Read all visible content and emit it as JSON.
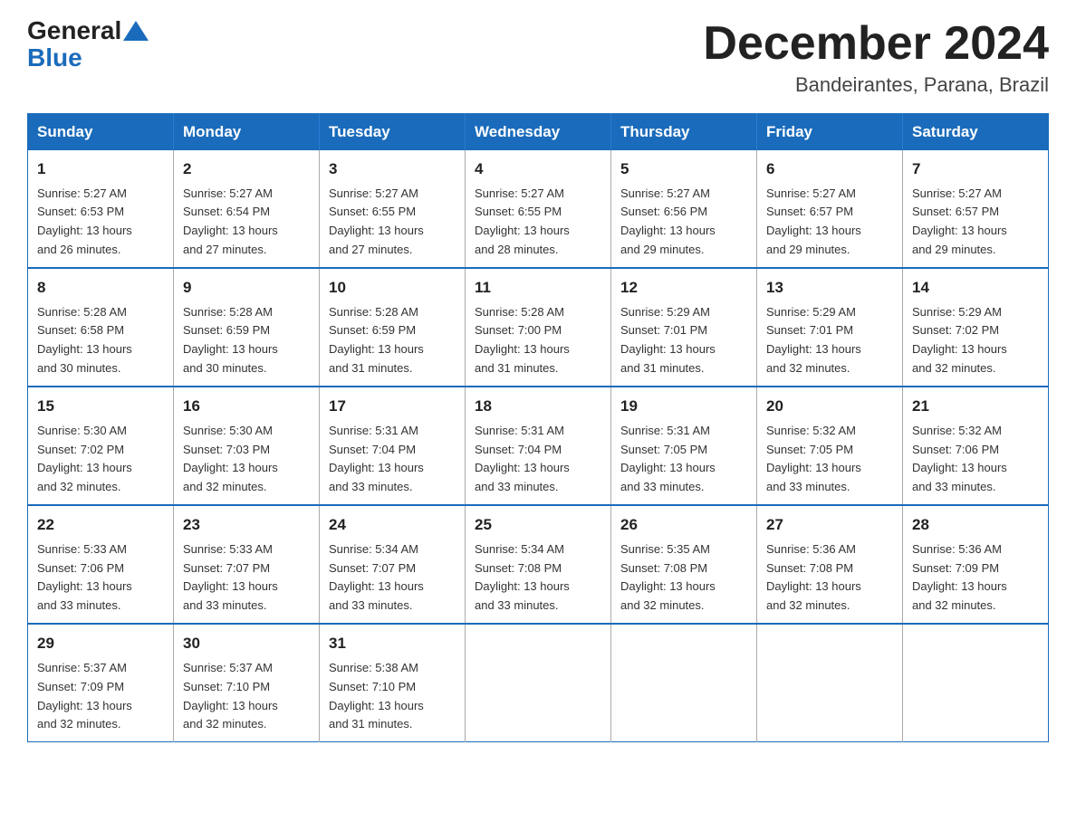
{
  "logo": {
    "general": "General",
    "blue": "Blue"
  },
  "header": {
    "title": "December 2024",
    "subtitle": "Bandeirantes, Parana, Brazil"
  },
  "days_of_week": [
    "Sunday",
    "Monday",
    "Tuesday",
    "Wednesday",
    "Thursday",
    "Friday",
    "Saturday"
  ],
  "weeks": [
    [
      {
        "day": "1",
        "sunrise": "5:27 AM",
        "sunset": "6:53 PM",
        "daylight": "13 hours and 26 minutes."
      },
      {
        "day": "2",
        "sunrise": "5:27 AM",
        "sunset": "6:54 PM",
        "daylight": "13 hours and 27 minutes."
      },
      {
        "day": "3",
        "sunrise": "5:27 AM",
        "sunset": "6:55 PM",
        "daylight": "13 hours and 27 minutes."
      },
      {
        "day": "4",
        "sunrise": "5:27 AM",
        "sunset": "6:55 PM",
        "daylight": "13 hours and 28 minutes."
      },
      {
        "day": "5",
        "sunrise": "5:27 AM",
        "sunset": "6:56 PM",
        "daylight": "13 hours and 29 minutes."
      },
      {
        "day": "6",
        "sunrise": "5:27 AM",
        "sunset": "6:57 PM",
        "daylight": "13 hours and 29 minutes."
      },
      {
        "day": "7",
        "sunrise": "5:27 AM",
        "sunset": "6:57 PM",
        "daylight": "13 hours and 29 minutes."
      }
    ],
    [
      {
        "day": "8",
        "sunrise": "5:28 AM",
        "sunset": "6:58 PM",
        "daylight": "13 hours and 30 minutes."
      },
      {
        "day": "9",
        "sunrise": "5:28 AM",
        "sunset": "6:59 PM",
        "daylight": "13 hours and 30 minutes."
      },
      {
        "day": "10",
        "sunrise": "5:28 AM",
        "sunset": "6:59 PM",
        "daylight": "13 hours and 31 minutes."
      },
      {
        "day": "11",
        "sunrise": "5:28 AM",
        "sunset": "7:00 PM",
        "daylight": "13 hours and 31 minutes."
      },
      {
        "day": "12",
        "sunrise": "5:29 AM",
        "sunset": "7:01 PM",
        "daylight": "13 hours and 31 minutes."
      },
      {
        "day": "13",
        "sunrise": "5:29 AM",
        "sunset": "7:01 PM",
        "daylight": "13 hours and 32 minutes."
      },
      {
        "day": "14",
        "sunrise": "5:29 AM",
        "sunset": "7:02 PM",
        "daylight": "13 hours and 32 minutes."
      }
    ],
    [
      {
        "day": "15",
        "sunrise": "5:30 AM",
        "sunset": "7:02 PM",
        "daylight": "13 hours and 32 minutes."
      },
      {
        "day": "16",
        "sunrise": "5:30 AM",
        "sunset": "7:03 PM",
        "daylight": "13 hours and 32 minutes."
      },
      {
        "day": "17",
        "sunrise": "5:31 AM",
        "sunset": "7:04 PM",
        "daylight": "13 hours and 33 minutes."
      },
      {
        "day": "18",
        "sunrise": "5:31 AM",
        "sunset": "7:04 PM",
        "daylight": "13 hours and 33 minutes."
      },
      {
        "day": "19",
        "sunrise": "5:31 AM",
        "sunset": "7:05 PM",
        "daylight": "13 hours and 33 minutes."
      },
      {
        "day": "20",
        "sunrise": "5:32 AM",
        "sunset": "7:05 PM",
        "daylight": "13 hours and 33 minutes."
      },
      {
        "day": "21",
        "sunrise": "5:32 AM",
        "sunset": "7:06 PM",
        "daylight": "13 hours and 33 minutes."
      }
    ],
    [
      {
        "day": "22",
        "sunrise": "5:33 AM",
        "sunset": "7:06 PM",
        "daylight": "13 hours and 33 minutes."
      },
      {
        "day": "23",
        "sunrise": "5:33 AM",
        "sunset": "7:07 PM",
        "daylight": "13 hours and 33 minutes."
      },
      {
        "day": "24",
        "sunrise": "5:34 AM",
        "sunset": "7:07 PM",
        "daylight": "13 hours and 33 minutes."
      },
      {
        "day": "25",
        "sunrise": "5:34 AM",
        "sunset": "7:08 PM",
        "daylight": "13 hours and 33 minutes."
      },
      {
        "day": "26",
        "sunrise": "5:35 AM",
        "sunset": "7:08 PM",
        "daylight": "13 hours and 32 minutes."
      },
      {
        "day": "27",
        "sunrise": "5:36 AM",
        "sunset": "7:08 PM",
        "daylight": "13 hours and 32 minutes."
      },
      {
        "day": "28",
        "sunrise": "5:36 AM",
        "sunset": "7:09 PM",
        "daylight": "13 hours and 32 minutes."
      }
    ],
    [
      {
        "day": "29",
        "sunrise": "5:37 AM",
        "sunset": "7:09 PM",
        "daylight": "13 hours and 32 minutes."
      },
      {
        "day": "30",
        "sunrise": "5:37 AM",
        "sunset": "7:10 PM",
        "daylight": "13 hours and 32 minutes."
      },
      {
        "day": "31",
        "sunrise": "5:38 AM",
        "sunset": "7:10 PM",
        "daylight": "13 hours and 31 minutes."
      },
      null,
      null,
      null,
      null
    ]
  ],
  "labels": {
    "sunrise": "Sunrise:",
    "sunset": "Sunset:",
    "daylight": "Daylight:"
  }
}
